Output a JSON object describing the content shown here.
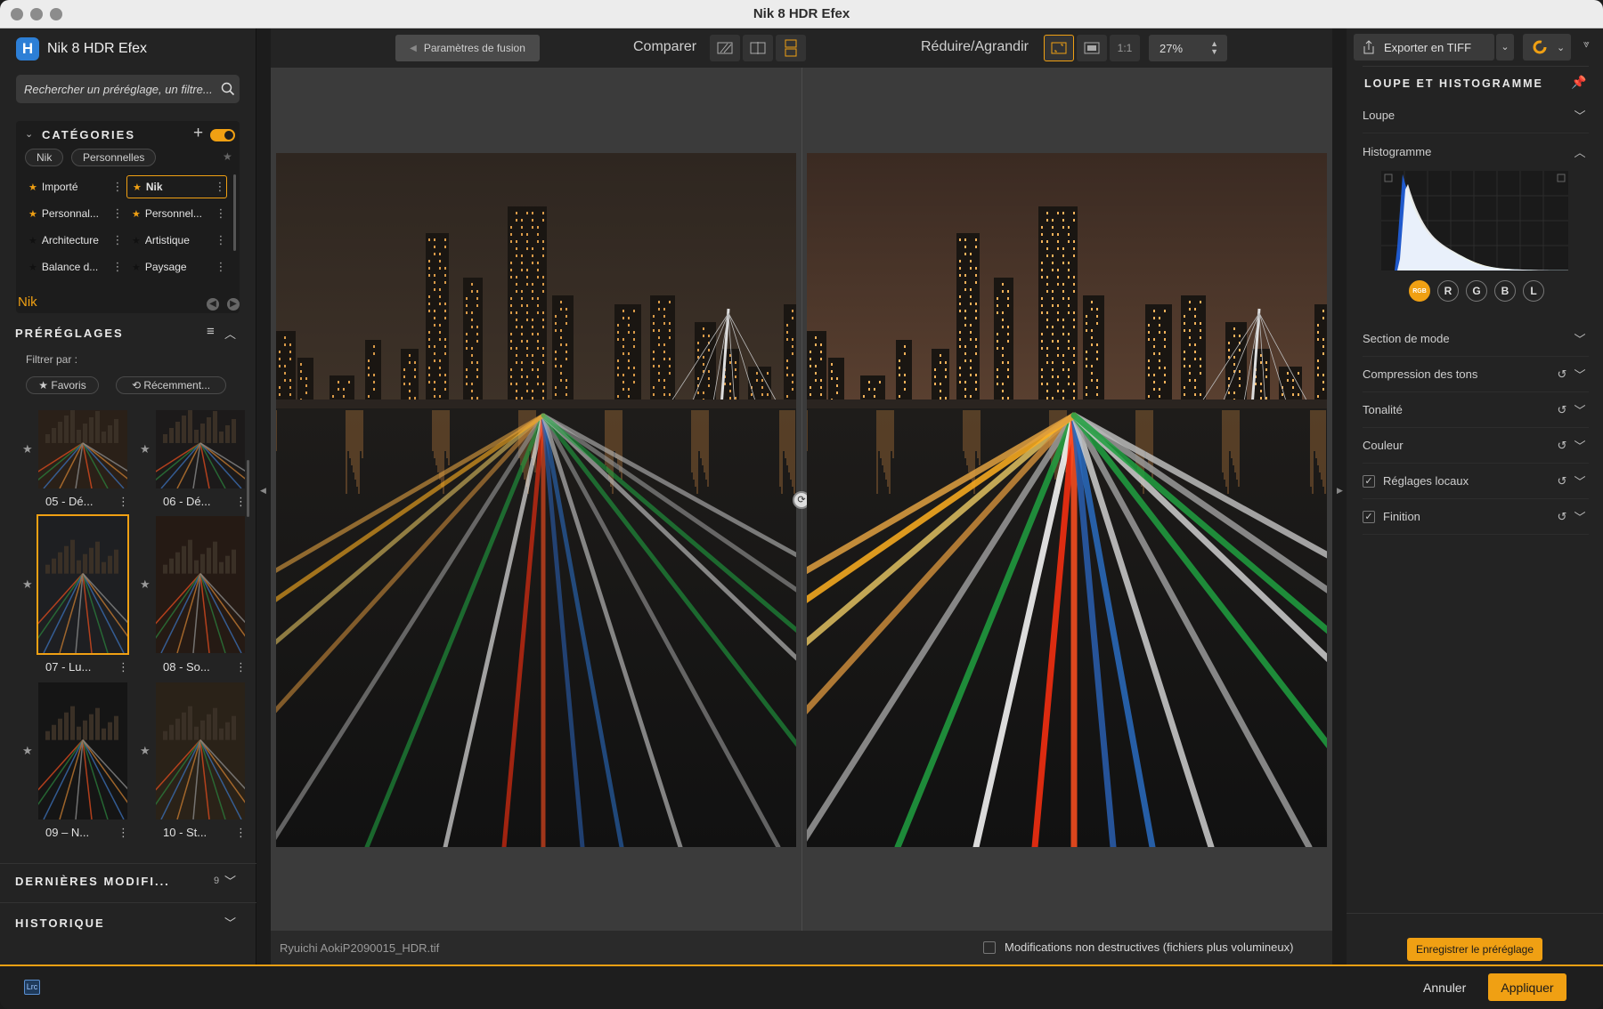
{
  "window": {
    "title": "Nik 8 HDR Efex"
  },
  "app": {
    "logo_letter": "H",
    "name": "Nik 8 HDR Efex"
  },
  "search": {
    "placeholder": "Rechercher un préréglage, un filtre..."
  },
  "categories": {
    "title": "CATÉGORIES",
    "tabs": [
      "Nik",
      "Personnelles"
    ],
    "items": [
      {
        "label": "Importé",
        "star_color": "#f0a013",
        "selected": false
      },
      {
        "label": "Nik",
        "star_color": "#f0a013",
        "selected": true
      },
      {
        "label": "Personnal...",
        "star_color": "#f0a013",
        "selected": false
      },
      {
        "label": "Personnel...",
        "star_color": "#f0a013",
        "selected": false
      },
      {
        "label": "Architecture",
        "star_color": "#111111",
        "selected": false
      },
      {
        "label": "Artistique",
        "star_color": "#111111",
        "selected": false
      },
      {
        "label": "Balance d...",
        "star_color": "#111111",
        "selected": false
      },
      {
        "label": "Paysage",
        "star_color": "#111111",
        "selected": false
      }
    ]
  },
  "presets": {
    "current_category": "Nik",
    "title": "PRÉRÉGLAGES",
    "filter_label": "Filtrer par :",
    "filters": [
      "Favoris",
      "Récemment..."
    ],
    "thumbnails": [
      {
        "label": "05 - Dé...",
        "selected": false
      },
      {
        "label": "06 - Dé...",
        "selected": false
      },
      {
        "label": "07 - Lu...",
        "selected": true
      },
      {
        "label": "08 - So...",
        "selected": false
      },
      {
        "label": "09 – N...",
        "selected": false
      },
      {
        "label": "10 - St...",
        "selected": false
      }
    ]
  },
  "recent_changes": {
    "title": "DERNIÈRES MODIFI...",
    "count": "9"
  },
  "history": {
    "title": "HISTORIQUE"
  },
  "toolbar": {
    "fusion_button": "Paramètres de fusion",
    "compare_label": "Comparer",
    "zoom_label": "Réduire/Agrandir",
    "one_to_one": "1:1",
    "zoom_value": "27%"
  },
  "status": {
    "filename": "Ryuichi AokiP2090015_HDR.tif",
    "nondestructive_label": "Modifications non destructives (fichiers plus volumineux)"
  },
  "right_panel": {
    "export_label": "Exporter en TIFF",
    "loupe_section_title": "LOUPE ET HISTOGRAMME",
    "loupe_label": "Loupe",
    "histogram_label": "Histogramme",
    "channels": [
      "RGB",
      "R",
      "G",
      "B",
      "L"
    ],
    "sections": [
      {
        "label": "Section de mode",
        "checkbox": false,
        "reset": false
      },
      {
        "label": "Compression des tons",
        "checkbox": false,
        "reset": true
      },
      {
        "label": "Tonalité",
        "checkbox": false,
        "reset": true
      },
      {
        "label": "Couleur",
        "checkbox": false,
        "reset": true
      },
      {
        "label": "Réglages locaux",
        "checkbox": true,
        "reset": true
      },
      {
        "label": "Finition",
        "checkbox": true,
        "reset": true
      }
    ],
    "save_preset_button": "Enregistrer le préréglage"
  },
  "bottom": {
    "lrc_badge": "Lrc",
    "cancel": "Annuler",
    "apply": "Appliquer"
  },
  "colors": {
    "accent": "#f0a013",
    "panel": "#232323",
    "canvas": "#3b3b3b"
  }
}
